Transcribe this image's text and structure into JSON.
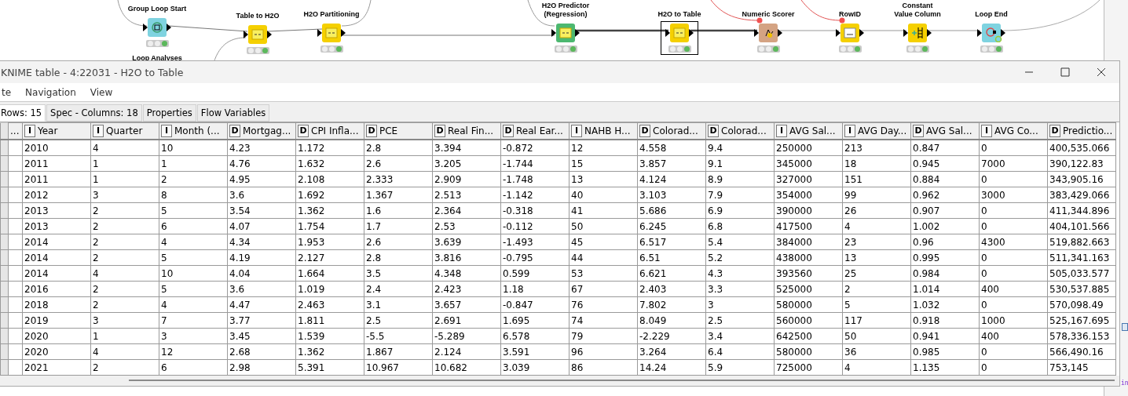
{
  "canvas": {
    "nodes": [
      {
        "title_lines": [
          "Group Loop Start"
        ],
        "caption": "Loop Analyses",
        "kind": "loop-start",
        "color": "#7fd3e0",
        "selected": false,
        "executed": true
      },
      {
        "title_lines": [
          "Table to H2O"
        ],
        "kind": "h2o",
        "color": "#f5d000",
        "selected": false,
        "executed": true
      },
      {
        "title_lines": [
          "H2O Partitioning"
        ],
        "kind": "h2o",
        "color": "#f5d000",
        "selected": false,
        "executed": true
      },
      {
        "title_lines": [
          "H2O Predictor",
          "(Regression)"
        ],
        "kind": "h2o",
        "color": "#4cb870",
        "selected": false,
        "executed": true
      },
      {
        "title_lines": [
          "H2O to Table"
        ],
        "kind": "h2o",
        "color": "#f5d000",
        "selected": true,
        "executed": true
      },
      {
        "title_lines": [
          "Numeric Scorer"
        ],
        "kind": "scorer",
        "color": "#d4a383",
        "selected": false,
        "executed": true
      },
      {
        "title_lines": [
          "RowID"
        ],
        "kind": "rowid",
        "color": "#f5d000",
        "selected": false,
        "executed": true
      },
      {
        "title_lines": [
          "Constant",
          "Value Column"
        ],
        "kind": "constant",
        "color": "#f5d000",
        "selected": false,
        "executed": true
      },
      {
        "title_lines": [
          "Loop End"
        ],
        "kind": "loop-end",
        "color": "#7fd3e0",
        "selected": false,
        "executed": true
      }
    ]
  },
  "side_text": "in",
  "window": {
    "title": "KNIME table - 4:22031 - H2O to Table",
    "menu": [
      "te",
      "Navigation",
      "View"
    ],
    "tabs": [
      {
        "label": "Rows: 15",
        "selected": true
      },
      {
        "label": "Spec - Columns: 18",
        "selected": false
      },
      {
        "label": "Properties",
        "selected": false
      },
      {
        "label": "Flow Variables",
        "selected": false
      }
    ],
    "table": {
      "row_header_label": "...",
      "columns": [
        {
          "type": "I",
          "name": "Year"
        },
        {
          "type": "I",
          "name": "Quarter"
        },
        {
          "type": "I",
          "name": "Month (..."
        },
        {
          "type": "D",
          "name": "Mortgag..."
        },
        {
          "type": "D",
          "name": "CPI Infla..."
        },
        {
          "type": "D",
          "name": "PCE"
        },
        {
          "type": "D",
          "name": "Real Fin..."
        },
        {
          "type": "D",
          "name": "Real Ear..."
        },
        {
          "type": "I",
          "name": "NAHB H..."
        },
        {
          "type": "D",
          "name": "Colorad..."
        },
        {
          "type": "D",
          "name": "Colorad..."
        },
        {
          "type": "I",
          "name": "AVG Sal..."
        },
        {
          "type": "I",
          "name": "AVG Day..."
        },
        {
          "type": "D",
          "name": "AVG Sal..."
        },
        {
          "type": "I",
          "name": "AVG Co..."
        },
        {
          "type": "D",
          "name": "Predictio..."
        }
      ],
      "rows": [
        [
          "2010",
          "4",
          "10",
          "4.23",
          "1.172",
          "2.8",
          "3.394",
          "-0.872",
          "12",
          "4.558",
          "9.4",
          "250000",
          "213",
          "0.847",
          "0",
          "400,535.066"
        ],
        [
          "2011",
          "1",
          "1",
          "4.76",
          "1.632",
          "2.6",
          "3.205",
          "-1.744",
          "15",
          "3.857",
          "9.1",
          "345000",
          "18",
          "0.945",
          "7000",
          "390,122.83"
        ],
        [
          "2011",
          "1",
          "2",
          "4.95",
          "2.108",
          "2.333",
          "2.909",
          "-1.748",
          "13",
          "4.124",
          "8.9",
          "327000",
          "151",
          "0.884",
          "0",
          "343,905.16"
        ],
        [
          "2012",
          "3",
          "8",
          "3.6",
          "1.692",
          "1.367",
          "2.513",
          "-1.142",
          "40",
          "3.103",
          "7.9",
          "354000",
          "99",
          "0.962",
          "3000",
          "383,429.066"
        ],
        [
          "2013",
          "2",
          "5",
          "3.54",
          "1.362",
          "1.6",
          "2.364",
          "-0.318",
          "41",
          "5.686",
          "6.9",
          "390000",
          "26",
          "0.907",
          "0",
          "411,344.896"
        ],
        [
          "2013",
          "2",
          "6",
          "4.07",
          "1.754",
          "1.7",
          "2.53",
          "-0.112",
          "50",
          "6.245",
          "6.8",
          "417500",
          "4",
          "1.002",
          "0",
          "404,101.566"
        ],
        [
          "2014",
          "2",
          "4",
          "4.34",
          "1.953",
          "2.6",
          "3.639",
          "-1.493",
          "45",
          "6.517",
          "5.4",
          "384000",
          "23",
          "0.96",
          "4300",
          "519,882.663"
        ],
        [
          "2014",
          "2",
          "5",
          "4.19",
          "2.127",
          "2.8",
          "3.816",
          "-0.795",
          "44",
          "6.51",
          "5.2",
          "438000",
          "13",
          "0.995",
          "0",
          "511,341.163"
        ],
        [
          "2014",
          "4",
          "10",
          "4.04",
          "1.664",
          "3.5",
          "4.348",
          "0.599",
          "53",
          "6.621",
          "4.3",
          "393560",
          "25",
          "0.984",
          "0",
          "505,033.577"
        ],
        [
          "2016",
          "2",
          "5",
          "3.6",
          "1.019",
          "2.4",
          "2.423",
          "1.18",
          "67",
          "2.403",
          "3.3",
          "525000",
          "2",
          "1.014",
          "400",
          "530,537.885"
        ],
        [
          "2018",
          "2",
          "4",
          "4.47",
          "2.463",
          "3.1",
          "3.657",
          "-0.847",
          "76",
          "7.802",
          "3",
          "580000",
          "5",
          "1.032",
          "0",
          "570,098.49"
        ],
        [
          "2019",
          "3",
          "7",
          "3.77",
          "1.811",
          "2.5",
          "2.691",
          "1.695",
          "74",
          "8.049",
          "2.5",
          "560000",
          "117",
          "0.918",
          "1000",
          "525,167.695"
        ],
        [
          "2020",
          "1",
          "3",
          "3.45",
          "1.539",
          "-5.5",
          "-5.289",
          "6.578",
          "79",
          "-2.229",
          "3.4",
          "642500",
          "50",
          "0.941",
          "400",
          "578,336.153"
        ],
        [
          "2020",
          "4",
          "12",
          "2.68",
          "1.362",
          "1.867",
          "2.124",
          "3.591",
          "96",
          "3.264",
          "6.4",
          "580000",
          "36",
          "0.985",
          "0",
          "566,490.16"
        ],
        [
          "2021",
          "2",
          "6",
          "2.98",
          "5.391",
          "10.967",
          "10.682",
          "3.039",
          "86",
          "14.24",
          "5.9",
          "725000",
          "4",
          "1.135",
          "0",
          "753,145"
        ]
      ]
    }
  }
}
